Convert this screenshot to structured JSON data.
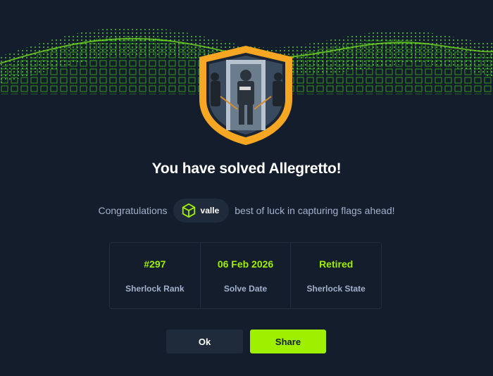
{
  "dialog": {
    "title": "You have solved Allegretto!",
    "congrats_prefix": "Congratulations",
    "username": "valle",
    "congrats_suffix": "best of luck in capturing flags ahead!",
    "user_icon": "hexagon-cube-icon",
    "badge_icon": "shield-badge-icon"
  },
  "stats": [
    {
      "value": "#297",
      "label": "Sherlock Rank"
    },
    {
      "value": "06 Feb 2026",
      "label": "Solve Date"
    },
    {
      "value": "Retired",
      "label": "Sherlock State"
    }
  ],
  "buttons": {
    "ok": "Ok",
    "share": "Share"
  },
  "colors": {
    "background": "#141d2b",
    "accent": "#9fef00",
    "muted_text": "#a4b1cd",
    "chip_bg": "#1f2a3a",
    "badge_orange": "#f5a623"
  }
}
